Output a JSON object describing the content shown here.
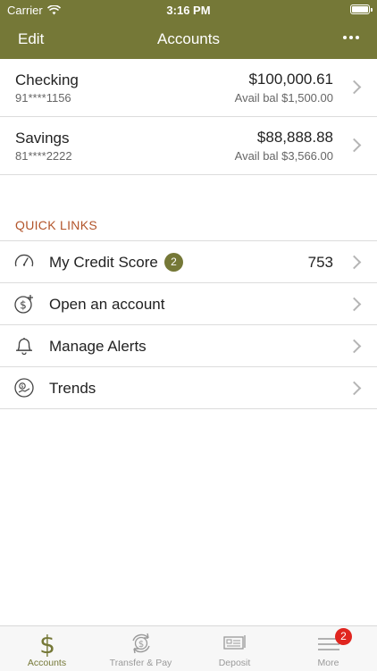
{
  "status_bar": {
    "carrier": "Carrier",
    "time": "3:16 PM"
  },
  "nav": {
    "edit_label": "Edit",
    "title": "Accounts",
    "more_icon": "ellipsis-icon"
  },
  "accounts": [
    {
      "name": "Checking",
      "number": "91****1156",
      "balance": "$100,000.61",
      "available": "Avail bal $1,500.00"
    },
    {
      "name": "Savings",
      "number": "81****2222",
      "balance": "$88,888.88",
      "available": "Avail bal $3,566.00"
    }
  ],
  "quick_links": {
    "title": "QUICK LINKS",
    "items": [
      {
        "label": "My Credit Score",
        "badge": "2",
        "value": "753",
        "icon": "gauge-icon"
      },
      {
        "label": "Open an account",
        "icon": "dollar-plus-icon"
      },
      {
        "label": "Manage Alerts",
        "icon": "bell-icon"
      },
      {
        "label": "Trends",
        "icon": "trends-icon"
      }
    ]
  },
  "tab_bar": {
    "tabs": [
      {
        "label": "Accounts",
        "icon": "dollar-icon",
        "active": true
      },
      {
        "label": "Transfer & Pay",
        "icon": "transfer-icon"
      },
      {
        "label": "Deposit",
        "icon": "check-deposit-icon"
      },
      {
        "label": "More",
        "icon": "menu-icon",
        "badge": "2"
      }
    ]
  },
  "colors": {
    "brand": "#757837",
    "accent_text": "#b2542a",
    "badge_red": "#e0251f"
  }
}
